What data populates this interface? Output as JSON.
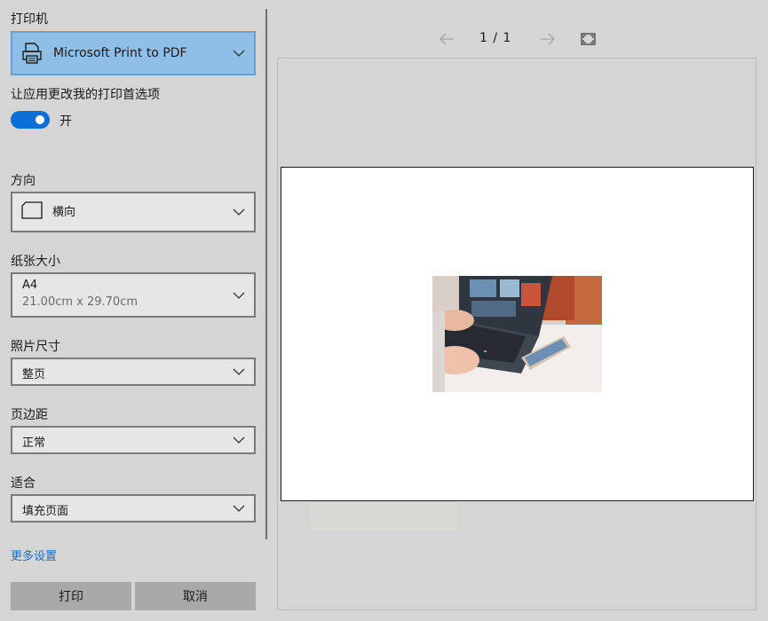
{
  "printer": {
    "section_label": "打印机",
    "selected": "Microsoft Print to PDF",
    "icon": "printer-icon"
  },
  "preferences": {
    "label": "让应用更改我的打印首选项",
    "toggle_state_label": "开",
    "toggle_on": true,
    "accent_color": "#0a6fd6"
  },
  "orientation": {
    "label": "方向",
    "selected": "横向",
    "icon": "page-landscape-icon"
  },
  "paper_size": {
    "label": "纸张大小",
    "selected": "A4",
    "dimensions": "21.00cm x 29.70cm"
  },
  "photo_size": {
    "label": "照片尺寸",
    "selected": "整页"
  },
  "margins": {
    "label": "页边距",
    "selected": "正常"
  },
  "fit": {
    "label": "适合",
    "selected": "填充页面"
  },
  "more_settings": "更多设置",
  "buttons": {
    "print": "打印",
    "cancel": "取消"
  },
  "preview": {
    "current_page": "1",
    "separator": "/",
    "total_pages": "1",
    "image_description_icon": "photo-thumbnail"
  }
}
